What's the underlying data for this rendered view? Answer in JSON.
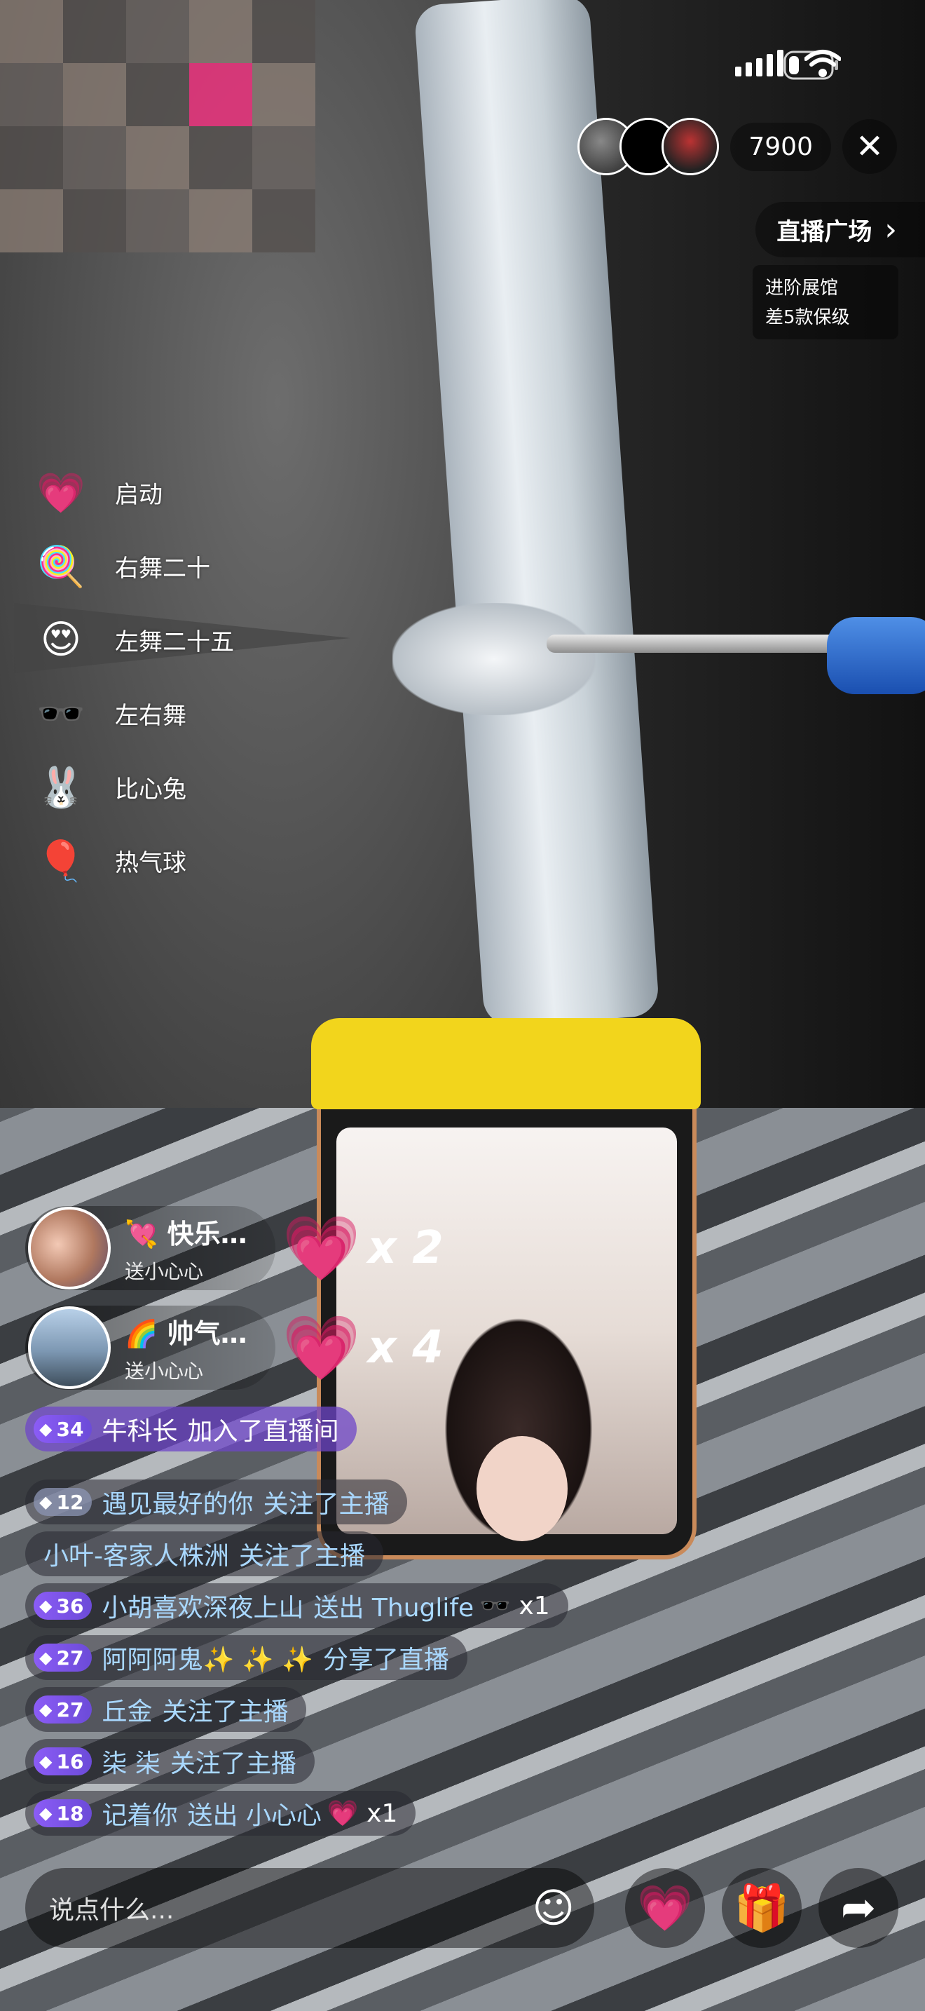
{
  "status_bar": {
    "icons": [
      "signal-icon",
      "wifi-icon",
      "battery-icon"
    ]
  },
  "top_right": {
    "viewer_count": "7900",
    "close_icon": "✕"
  },
  "plaza": {
    "label": "直播广场",
    "chevron": "›"
  },
  "hall": {
    "line1": "进阶展馆",
    "line2": "差5款保级"
  },
  "gift_menu": [
    {
      "icon": "💗",
      "label": "启动"
    },
    {
      "icon": "🍭",
      "label": "右舞二十"
    },
    {
      "icon": "😍",
      "label": "左舞二十五"
    },
    {
      "icon": "🕶️",
      "label": "左右舞"
    },
    {
      "icon": "🐰",
      "label": "比心兔"
    },
    {
      "icon": "🎈",
      "label": "热气球"
    }
  ],
  "gift_notices": [
    {
      "prefix": "💘",
      "name": "快乐…",
      "sub": "送小心心",
      "heart": "💗",
      "count": "x 2"
    },
    {
      "prefix": "🌈",
      "name": "帅气…",
      "sub": "送小心心",
      "heart": "💗",
      "count": "x 4"
    }
  ],
  "chat": [
    {
      "type": "join",
      "level": "34",
      "user": "牛科长",
      "action": "加入了直播间",
      "extra": ""
    },
    {
      "type": "follow",
      "level": "12",
      "user": "遇见最好的你",
      "action": "关注了主播",
      "extra": ""
    },
    {
      "type": "plain",
      "level": "",
      "user": "小叶-客家人株洲",
      "action": "关注了主播",
      "extra": ""
    },
    {
      "type": "gift",
      "level": "36",
      "user": "小胡喜欢深夜上山",
      "action": "送出 Thuglife",
      "extra": "🕶️ x1"
    },
    {
      "type": "share",
      "level": "27",
      "user": "阿阿阿鬼✨ ✨ ✨",
      "action": "分享了直播",
      "extra": ""
    },
    {
      "type": "follow",
      "level": "27",
      "user": "丘金",
      "action": "关注了主播",
      "extra": ""
    },
    {
      "type": "follow",
      "level": "16",
      "user": "柒 柒",
      "action": "关注了主播",
      "extra": ""
    },
    {
      "type": "gift",
      "level": "18",
      "user": "记着你",
      "action": "送出 小心心",
      "extra": "💗 x1"
    }
  ],
  "bottom": {
    "placeholder": "说点什么...",
    "emoji_icon": "☺",
    "heart_icon": "💗",
    "gift_icon": "🎁",
    "share_icon": "➦"
  }
}
